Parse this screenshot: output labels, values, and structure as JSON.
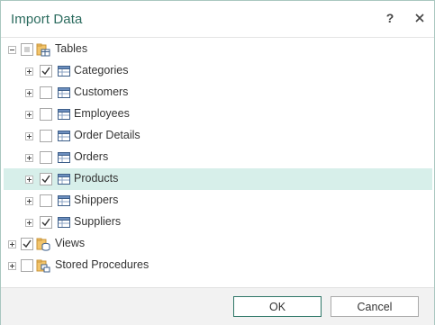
{
  "dialog": {
    "title": "Import Data",
    "help_label": "?"
  },
  "tree": {
    "root": {
      "label": "Tables",
      "expanded": true,
      "checked": "indeterminate"
    },
    "tables": [
      {
        "label": "Categories",
        "checked": true,
        "selected": false
      },
      {
        "label": "Customers",
        "checked": false,
        "selected": false
      },
      {
        "label": "Employees",
        "checked": false,
        "selected": false
      },
      {
        "label": "Order Details",
        "checked": false,
        "selected": false
      },
      {
        "label": "Orders",
        "checked": false,
        "selected": false
      },
      {
        "label": "Products",
        "checked": true,
        "selected": true
      },
      {
        "label": "Shippers",
        "checked": false,
        "selected": false
      },
      {
        "label": "Suppliers",
        "checked": true,
        "selected": false
      }
    ],
    "views": {
      "label": "Views",
      "checked": true
    },
    "stored_procedures": {
      "label": "Stored Procedures",
      "checked": false
    }
  },
  "footer": {
    "ok_label": "OK",
    "cancel_label": "Cancel"
  },
  "colors": {
    "title": "#2b6b5e",
    "selection": "#d7efea",
    "primary_border": "#2f7768"
  },
  "icons": {
    "table": "table-icon",
    "folder": "database-folder-icon",
    "procedure": "stored-procedure-icon"
  }
}
